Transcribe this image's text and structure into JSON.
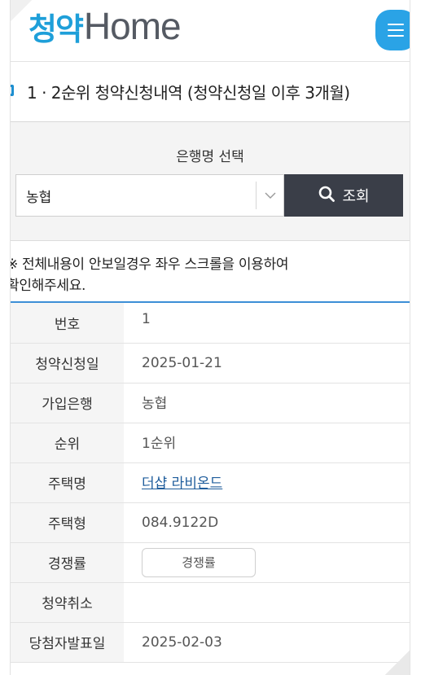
{
  "header": {
    "logo_ko": "청약",
    "logo_en": "Home",
    "menu_icon": "hamburger-menu-icon"
  },
  "title": "1 · 2순위 청약신청내역 (청약신청일 이후 3개월)",
  "search": {
    "label": "은행명 선택",
    "selected_bank": "농협",
    "button_label": "조회",
    "button_icon": "search-icon"
  },
  "notice": {
    "line1": "※ 전체내용이 안보일경우 좌우 스크롤을 이용하여",
    "line2": "확인해주세요."
  },
  "rows": [
    {
      "label": "번호",
      "value": "1"
    },
    {
      "label": "청약신청일",
      "value": "2025-01-21"
    },
    {
      "label": "가입은행",
      "value": "농협"
    },
    {
      "label": "순위",
      "value": "1순위"
    },
    {
      "label": "주택명",
      "value": "더샵 라비온드"
    },
    {
      "label": "주택형",
      "value": "084.9122D"
    },
    {
      "label": "경쟁률",
      "value": "경쟁률"
    },
    {
      "label": "청약취소",
      "value": ""
    },
    {
      "label": "당첨자발표일",
      "value": "2025-02-03"
    }
  ],
  "colors": {
    "brand_blue": "#1e9fd9",
    "menu_button": "#2aa3e6",
    "search_button": "#3a3e48",
    "link": "#1f5d9c"
  }
}
